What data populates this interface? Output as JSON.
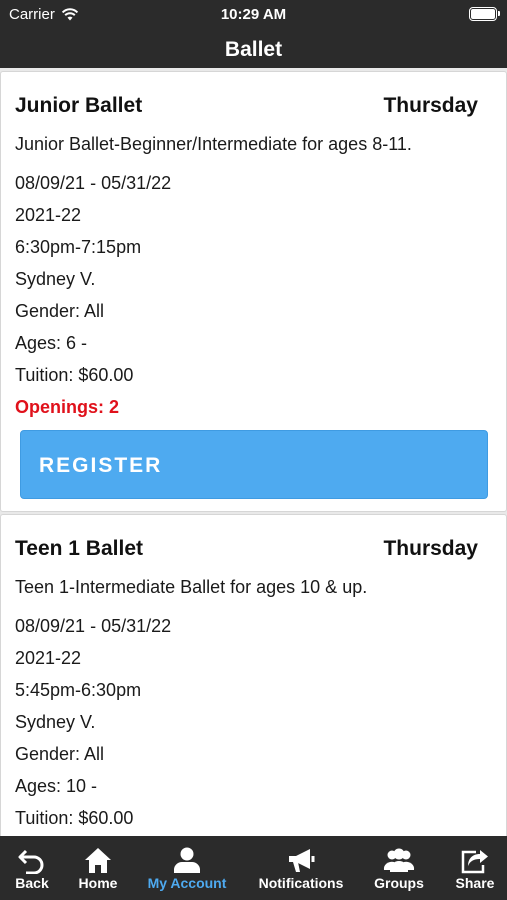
{
  "status_bar": {
    "carrier": "Carrier",
    "time": "10:29 AM"
  },
  "header": {
    "title": "Ballet"
  },
  "classes": [
    {
      "name": "Junior Ballet",
      "day": "Thursday",
      "description": "Junior Ballet-Beginner/Intermediate for ages 8-11.",
      "dates": "08/09/21 - 05/31/22",
      "season": "2021-22",
      "time": "6:30pm-7:15pm",
      "instructor": "Sydney V.",
      "gender": "Gender: All",
      "ages": "Ages: 6 -",
      "tuition": "Tuition: $60.00",
      "openings": "Openings: 2",
      "register_label": "REGISTER"
    },
    {
      "name": "Teen 1 Ballet",
      "day": "Thursday",
      "description": "Teen 1-Intermediate Ballet for ages 10 & up.",
      "dates": "08/09/21 - 05/31/22",
      "season": "2021-22",
      "time": "5:45pm-6:30pm",
      "instructor": "Sydney V.",
      "gender": "Gender: All",
      "ages": "Ages: 10 -",
      "tuition": "Tuition: $60.00"
    }
  ],
  "tab_bar": {
    "active_color": "#4eaaf0",
    "items": [
      {
        "label": "Back",
        "icon": "back-arrow-icon"
      },
      {
        "label": "Home",
        "icon": "home-icon"
      },
      {
        "label": "My Account",
        "icon": "person-icon",
        "active": true
      },
      {
        "label": "Notifications",
        "icon": "megaphone-icon"
      },
      {
        "label": "Groups",
        "icon": "group-icon"
      },
      {
        "label": "Share",
        "icon": "share-icon"
      }
    ]
  }
}
